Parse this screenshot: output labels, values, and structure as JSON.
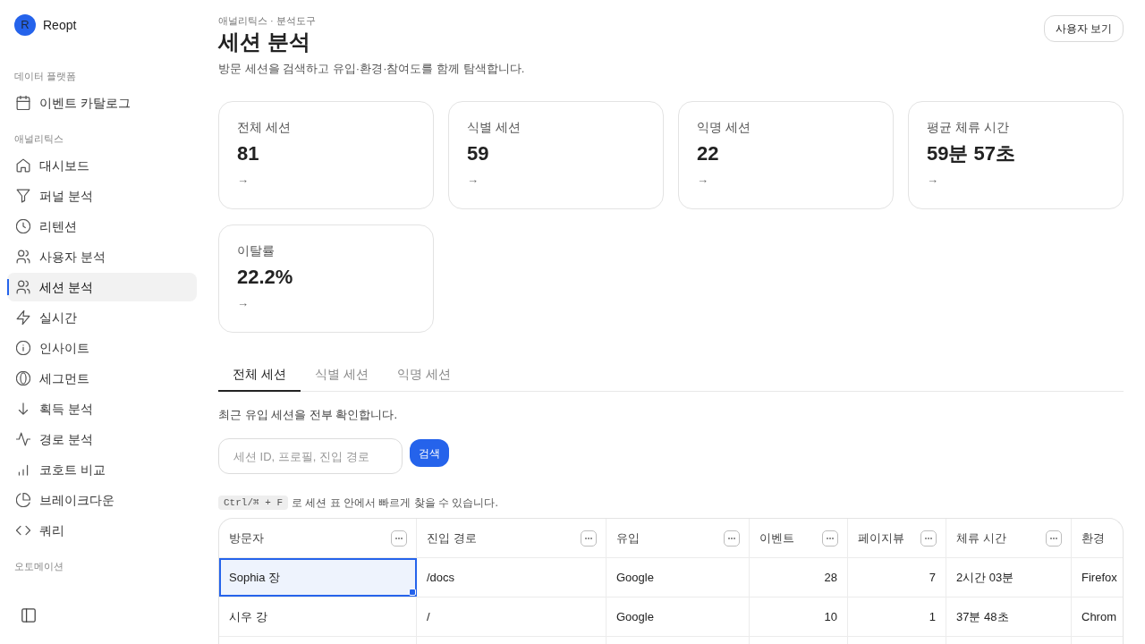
{
  "sidebar": {
    "brand": {
      "initial": "R",
      "name": "Reopt"
    },
    "sections": [
      {
        "title": "데이터 플랫폼",
        "items": [
          {
            "label": "이벤트 카탈로그",
            "selected": false
          }
        ]
      },
      {
        "title": "애널리틱스",
        "items": [
          {
            "label": "대시보드",
            "selected": false
          },
          {
            "label": "퍼널 분석",
            "selected": false
          },
          {
            "label": "리텐션",
            "selected": false
          },
          {
            "label": "사용자 분석",
            "selected": false
          },
          {
            "label": "세션 분석",
            "selected": true
          },
          {
            "label": "실시간",
            "selected": false
          },
          {
            "label": "인사이트",
            "selected": false
          },
          {
            "label": "세그먼트",
            "selected": false
          },
          {
            "label": "획득 분석",
            "selected": false
          },
          {
            "label": "경로 분석",
            "selected": false
          },
          {
            "label": "코호트 비교",
            "selected": false
          },
          {
            "label": "브레이크다운",
            "selected": false
          },
          {
            "label": "쿼리",
            "selected": false
          }
        ]
      },
      {
        "title": "오토메이션"
      }
    ]
  },
  "header": {
    "breadcrumb": "애널리틱스 · 분석도구",
    "title": "세션 분석",
    "description": "방문 세션을 검색하고 유입·환경·참여도를 함께 탐색합니다.",
    "action": "사용자 보기"
  },
  "stats": [
    {
      "label": "전체 세션",
      "value": "81",
      "arrow": "→"
    },
    {
      "label": "식별 세션",
      "value": "59",
      "arrow": "→"
    },
    {
      "label": "익명 세션",
      "value": "22",
      "arrow": "→"
    },
    {
      "label": "평균 체류 시간",
      "value": "59분 57초",
      "arrow": "→"
    },
    {
      "label": "이탈률",
      "value": "22.2%",
      "arrow": "→"
    }
  ],
  "tabs": [
    {
      "label": "전체 세션",
      "selected": true
    },
    {
      "label": "식별 세션",
      "selected": false
    },
    {
      "label": "익명 세션",
      "selected": false
    }
  ],
  "tab_description": "최근 유입 세션을 전부 확인합니다.",
  "search": {
    "placeholder": "세션 ID, 프로필, 진입 경로",
    "button": "검색"
  },
  "shortcut_hint": {
    "keys": "Ctrl/⌘ + F",
    "text": "로 세션 표 안에서 빠르게 찾을 수 있습니다."
  },
  "table": {
    "columns": [
      {
        "label": "방문자",
        "kind": "text",
        "menu_button": true
      },
      {
        "label": "진입 경로",
        "kind": "text",
        "menu_button": true
      },
      {
        "label": "유입",
        "kind": "text",
        "menu_button": true
      },
      {
        "label": "이벤트",
        "kind": "number",
        "menu_button": true
      },
      {
        "label": "페이지뷰",
        "kind": "number",
        "menu_button": true
      },
      {
        "label": "체류 시간",
        "kind": "text",
        "menu_button": true
      },
      {
        "label": "환경",
        "kind": "text",
        "menu_button": false
      }
    ],
    "rows": [
      {
        "cells": [
          {
            "text": "Sophia 장",
            "selected": true
          },
          {
            "text": "/docs",
            "selected": false
          },
          {
            "text": "Google",
            "selected": false
          },
          {
            "text": "28",
            "selected": false
          },
          {
            "text": "7",
            "selected": false
          },
          {
            "text": "2시간 03분",
            "selected": false
          },
          {
            "text": "Firefox",
            "selected": false
          }
        ]
      },
      {
        "cells": [
          {
            "text": "시우 강",
            "selected": false
          },
          {
            "text": "/",
            "selected": false
          },
          {
            "text": "Google",
            "selected": false
          },
          {
            "text": "10",
            "selected": false
          },
          {
            "text": "1",
            "selected": false
          },
          {
            "text": "37분 48초",
            "selected": false
          },
          {
            "text": "Chrom",
            "selected": false
          }
        ]
      }
    ]
  }
}
